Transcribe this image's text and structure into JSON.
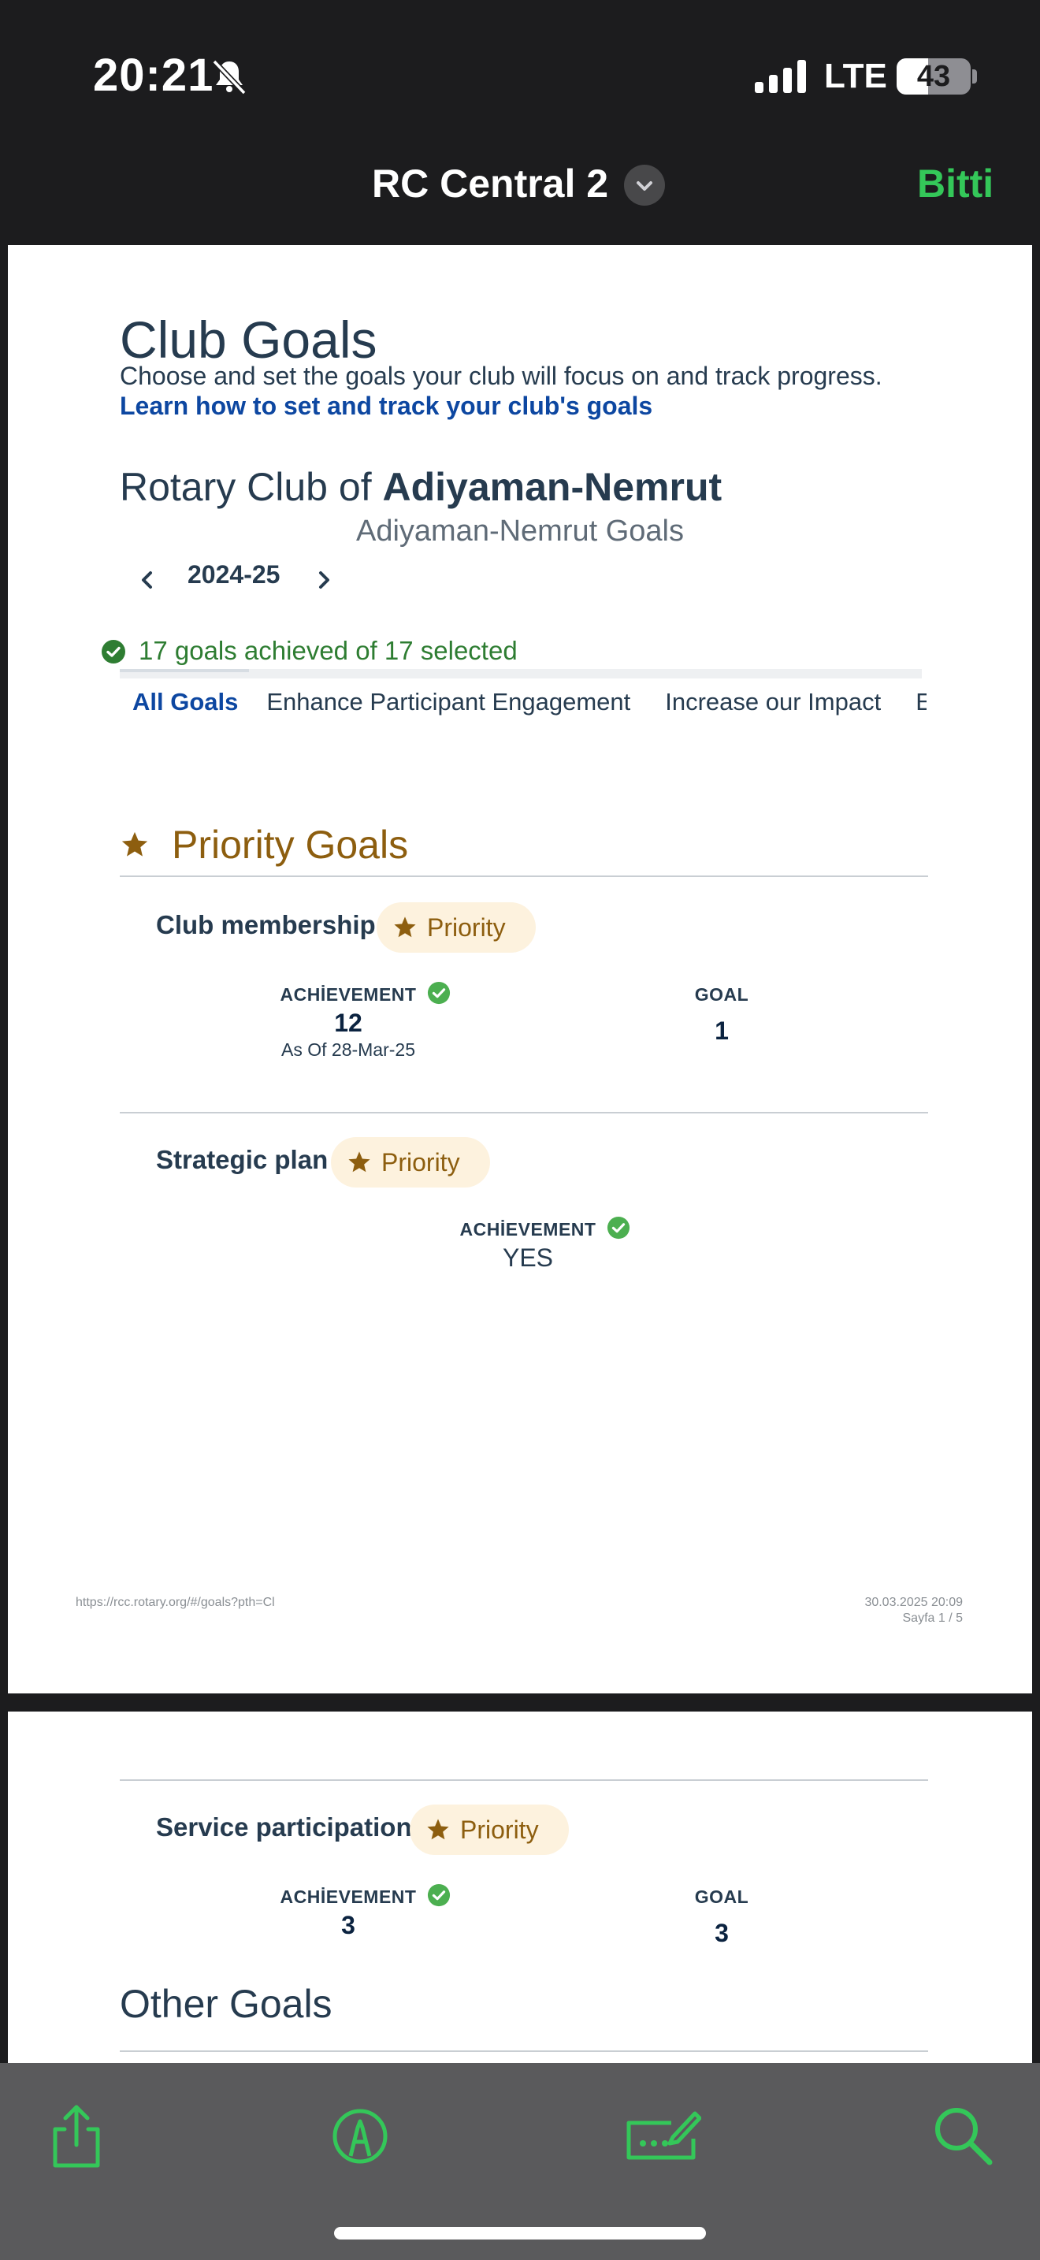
{
  "status_bar": {
    "time": "20:21",
    "network": "LTE",
    "battery_percent": 43,
    "battery_label": "43"
  },
  "nav": {
    "title": "RC Central 2",
    "done_label": "Bitti",
    "accent_color": "#34c759"
  },
  "document": {
    "heading": "Club Goals",
    "description": "Choose and set the goals your club will focus on and track progress.",
    "learn_link": "Learn how to set and track your club's goals",
    "club_prefix": "Rotary Club of",
    "club_name": "Adiyaman-Nemrut",
    "club_subtitle": "Adiyaman-Nemrut Goals",
    "year": "2024-25",
    "achieved_summary": "17 goals achieved of 17 selected",
    "tabs": [
      {
        "label": "All Goals",
        "active": true
      },
      {
        "label": "Enhance Participant Engagement",
        "active": false
      },
      {
        "label": "Increase our Impact",
        "active": false
      },
      {
        "label": "E",
        "active": false
      }
    ],
    "priority_section_title": "Priority Goals",
    "priority_badge": "Priority",
    "goals": [
      {
        "name": "Club membership",
        "achievement_label": "ACHİEVEMENT",
        "achievement_value": "12",
        "achievement_note": "As Of 28-Mar-25",
        "goal_label": "GOAL",
        "goal_value": "1"
      },
      {
        "name": "Strategic plan",
        "achievement_label": "ACHİEVEMENT",
        "achievement_value": "YES"
      },
      {
        "name": "Service participation",
        "achievement_label": "ACHİEVEMENT",
        "achievement_value": "3",
        "goal_label": "GOAL",
        "goal_value": "3"
      }
    ],
    "other_goals_title": "Other Goals",
    "footer": {
      "url": "https://rcc.rotary.org/#/goals?pth=Cl",
      "datetime": "30.03.2025 20:09",
      "page": "Sayfa 1 / 5"
    }
  },
  "toolbar": {
    "icons": [
      "share-icon",
      "markup-icon",
      "form-fill-icon",
      "search-icon"
    ]
  },
  "colors": {
    "heading": "#263b4f",
    "link": "#0d47a1",
    "success": "#2e7d32",
    "check": "#4caf50",
    "priority": "#8d5e0f",
    "badge_bg": "#fdf2de"
  }
}
